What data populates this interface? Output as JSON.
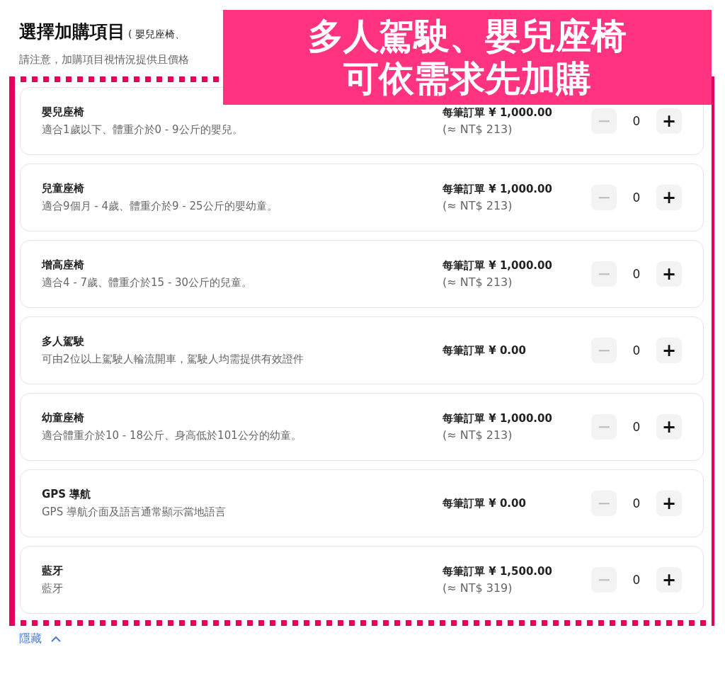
{
  "header": {
    "title": "選擇加購項目",
    "subtitle": "( 嬰兒座椅、",
    "notice": "請注意，加購項目視情況提供且價格"
  },
  "items": [
    {
      "name": "嬰兒座椅",
      "description": "適合1歲以下、體重介於0 - 9公斤的嬰兒。",
      "price": "每筆訂單 ¥ 1,000.00",
      "converted": "(≈ NT$ 213)",
      "quantity": "0",
      "minus_disabled": true,
      "plus": "+",
      "minus": "−"
    },
    {
      "name": "兒童座椅",
      "description": "適合9個月 - 4歲、體重介於9 - 25公斤的嬰幼童。",
      "price": "每筆訂單 ¥ 1,000.00",
      "converted": "(≈ NT$ 213)",
      "quantity": "0",
      "minus_disabled": true,
      "plus": "+",
      "minus": "−"
    },
    {
      "name": "增高座椅",
      "description": "適合4 - 7歲、體重介於15 - 30公斤的兒童。",
      "price": "每筆訂單 ¥ 1,000.00",
      "converted": "(≈ NT$ 213)",
      "quantity": "0",
      "minus_disabled": true,
      "plus": "+",
      "minus": "−"
    },
    {
      "name": "多人駕駛",
      "description": "可由2位以上駕駛人輪流開車，駕駛人均需提供有效證件",
      "price": "每筆訂單 ¥ 0.00",
      "quantity": "0",
      "minus_disabled": true,
      "plus": "+",
      "minus": "−"
    },
    {
      "name": "幼童座椅",
      "description": "適合體重介於10 - 18公斤、身高低於101公分的幼童。",
      "price": "每筆訂單 ¥ 1,000.00",
      "converted": "(≈ NT$ 213)",
      "quantity": "0",
      "minus_disabled": true,
      "plus": "+",
      "minus": "−"
    },
    {
      "name": "GPS 導航",
      "description": "GPS 導航介面及語言通常顯示當地語言",
      "price": "每筆訂單 ¥ 0.00",
      "quantity": "0",
      "minus_disabled": true,
      "plus": "+",
      "minus": "−"
    },
    {
      "name": "藍牙",
      "description": "藍牙",
      "price": "每筆訂單 ¥ 1,500.00",
      "converted": "(≈ NT$ 319)",
      "quantity": "0",
      "minus_disabled": true,
      "plus": "+",
      "minus": "−"
    }
  ],
  "hide_link": "隱藏",
  "banner": {
    "lines": [
      "多人駕駛、嬰兒座椅",
      "可依需求先加購"
    ]
  }
}
